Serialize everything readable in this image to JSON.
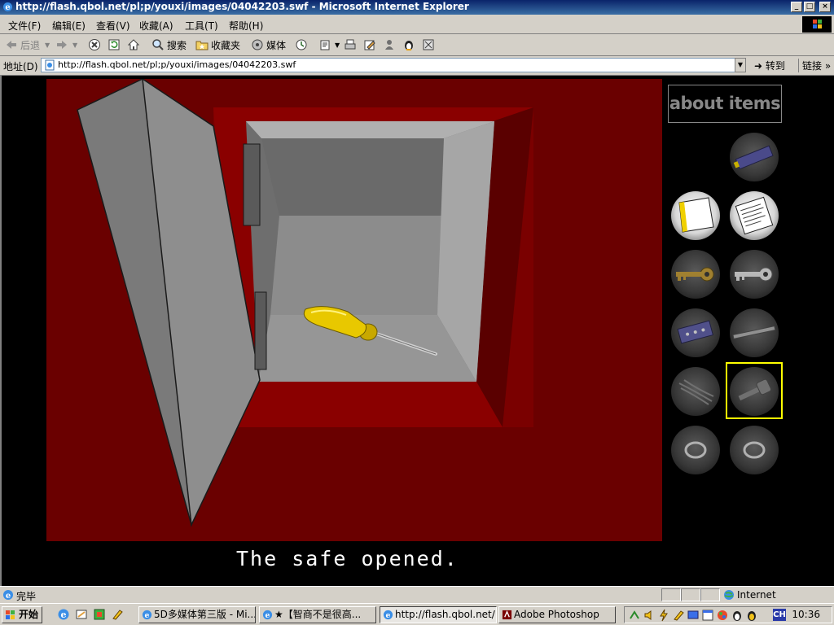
{
  "window": {
    "title": "http://flash.qbol.net/pl;p/youxi/images/04042203.swf - Microsoft Internet Explorer",
    "min_label": "_",
    "max_label": "□",
    "close_label": "×"
  },
  "menu": {
    "items": [
      "文件(F)",
      "编辑(E)",
      "查看(V)",
      "收藏(A)",
      "工具(T)",
      "帮助(H)"
    ]
  },
  "toolbar": {
    "back_label": "后退",
    "search_label": "搜索",
    "favorites_label": "收藏夹",
    "media_label": "媒体"
  },
  "address": {
    "label": "地址(D)",
    "url": "http://flash.qbol.net/pl;p/youxi/images/04042203.swf",
    "go_label": "转到",
    "links_label": "链接"
  },
  "game": {
    "message": "The safe opened.",
    "about_label": "about items",
    "inventory": [
      {
        "icon": "battery-icon",
        "lit": false
      },
      {
        "icon": "paper-card-icon",
        "lit": true
      },
      {
        "icon": "note-paper-icon",
        "lit": true
      },
      {
        "icon": "gold-key-icon",
        "lit": false
      },
      {
        "icon": "silver-key-icon",
        "lit": false
      },
      {
        "icon": "circuit-chip-icon",
        "lit": false
      },
      {
        "icon": "metal-rod-icon",
        "lit": false
      },
      {
        "icon": "cable-bundle-icon",
        "lit": false
      },
      {
        "icon": "gray-key-icon",
        "lit": false,
        "selected": true
      },
      {
        "icon": "ring-icon",
        "lit": false
      },
      {
        "icon": "ring-icon",
        "lit": false
      }
    ],
    "colors": {
      "wall": "#6a0000",
      "safe": "#8a8a8a",
      "screwdriver": "#e8c800",
      "highlight": "#ffff00"
    }
  },
  "status": {
    "text": "完毕",
    "zone": "Internet"
  },
  "taskbar": {
    "start_label": "开始",
    "tasks": [
      {
        "label": "5D多媒体第三版 - Mi...",
        "active": false
      },
      {
        "label": "★【智商不是很高...",
        "active": false
      },
      {
        "label": "http://flash.qbol.net/...",
        "active": true
      },
      {
        "label": "Adobe Photoshop",
        "active": false
      }
    ],
    "clock": "10:36",
    "lang": "CH"
  }
}
